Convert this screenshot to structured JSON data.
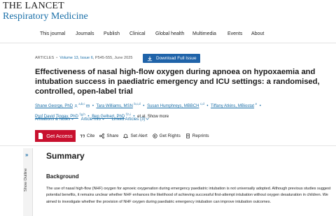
{
  "brand": {
    "line1": "THE LANCET",
    "line2": "Respiratory Medicine"
  },
  "nav": [
    "This journal",
    "Journals",
    "Publish",
    "Clinical",
    "Global health",
    "Multimedia",
    "Events",
    "About"
  ],
  "article": {
    "type": "ARTICLES",
    "volume": "Volume 13, Issue 6",
    "pages": "P545-555",
    "date": "June 2025",
    "download_label": "Download Full Issue",
    "title": "Effectiveness of nasal high-flow oxygen during apnoea on hypoxaemia and intubation success in paediatric emergency and ICU settings: a randomised, controlled, open-label trial"
  },
  "authors": [
    {
      "name": "Shane George, PhD",
      "sup": "a,b,c"
    },
    {
      "name": "Tara Williams, MSN",
      "sup": "b,c,d"
    },
    {
      "name": "Susan Humphreys, MBBCH",
      "sup": "c,d"
    },
    {
      "name": "Tiffany Atkins, MBiostat",
      "sup": "e"
    },
    {
      "name": "Prof David Tingay, PhD",
      "sup": "f,g,h"
    },
    {
      "name": "Ben Gelbart, PhD",
      "sup": "f,h,i"
    }
  ],
  "authors_tail": "et al. Show more",
  "links": {
    "affiliations": "Affiliations & Notes",
    "article_info": "Article Info",
    "linked": "Linked Articles (3)"
  },
  "actions": {
    "access": "Get Access",
    "cite": "Cite",
    "share": "Share",
    "alert": "Set Alert",
    "rights": "Get Rights",
    "reprints": "Reprints"
  },
  "outline": {
    "label": "Show Outline",
    "chevron": "»"
  },
  "summary": {
    "heading": "Summary",
    "subheading": "Background",
    "text": "The use of nasal high-flow (NHF) oxygen for apnoeic oxygenation during emergency paediatric intubation is not universally adopted. Although previous studies suggest potential benefits, it remains unclear whether NHF enhances the likelihood of achieving successful first-attempt intubation without oxygen desaturation in children. We aimed to investigate whether the provision of NHF oxygen during paediatric emergency intubation can improve intubation outcomes."
  },
  "colors": {
    "brand_blue": "#1a6fa8",
    "download_blue": "#1f63a9",
    "access_red": "#c8102e"
  }
}
